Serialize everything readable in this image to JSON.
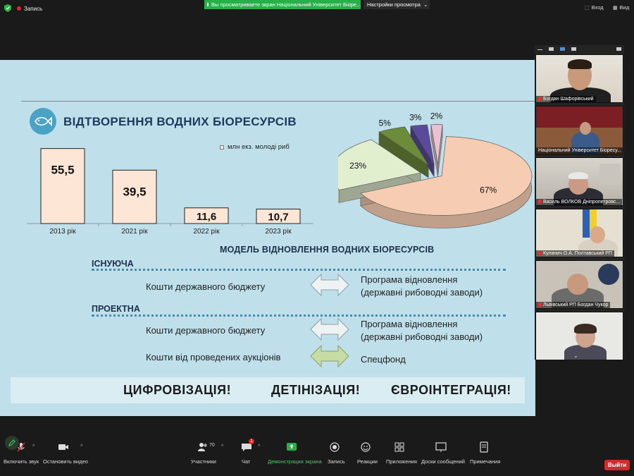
{
  "topbar": {
    "recording_label": "Запись",
    "share_banner": "Вы просматриваете экран Національний Університет Біоре...",
    "view_options": "Настройки просмотра",
    "exit_label": "Вход",
    "view_label": "Вид"
  },
  "slide": {
    "title": "ВІДТВОРЕННЯ ВОДНИХ БІОРЕСУРСІВ",
    "legend": "млн екз. молоді риб",
    "model_title": "МОДЕЛЬ ВІДНОВЛЕННЯ ВОДНИХ БІОРЕСУРСІВ",
    "existing_label": "ІСНУЮЧА",
    "project_label": "ПРОЕКТНА",
    "row1_source": "Кошти державного бюджету",
    "row1_dest_line1": "Програма відновлення",
    "row1_dest_line2": "(державні рибоводні заводи)",
    "row2_source": "Кошти державного бюджету",
    "row2_dest_line1": "Програма відновлення",
    "row2_dest_line2": "(державні рибоводні заводи)",
    "row3_source": "Кошти від проведених аукціонів",
    "row3_dest": "Спецфонд",
    "banner_1": "ЦИФРОВІЗАЦІЯ!",
    "banner_2": "ДЕТІНІЗАЦІЯ!",
    "banner_3": "ЄВРОІНТЕГРАЦІЯ!"
  },
  "chart_data": [
    {
      "type": "bar",
      "categories": [
        "2013 рік",
        "2021 рік",
        "2022 рік",
        "2023 рік"
      ],
      "values": [
        55.5,
        39.5,
        11.6,
        10.7
      ],
      "value_labels": [
        "55,5",
        "39,5",
        "11,6",
        "10,7"
      ],
      "legend": "млн екз. молоді риб",
      "ylim": [
        0,
        60
      ],
      "grid": false
    },
    {
      "type": "pie",
      "values": [
        67,
        23,
        5,
        3,
        2
      ],
      "labels": [
        "67%",
        "23%",
        "5%",
        "3%",
        "2%"
      ],
      "colors": [
        "#f6cdb2",
        "#e2efcf",
        "#6c8c3a",
        "#5a4a9a",
        "#e8c2d2"
      ]
    }
  ],
  "participants": [
    {
      "name": "Богдан Шафорівський",
      "muted": true
    },
    {
      "name": "Національний Університет Біоресу...",
      "muted": false
    },
    {
      "name": "Василь ВОЛКОВ Дніпропетровс...",
      "muted": true
    },
    {
      "name": "Кулинич О.А. Полтавський РП",
      "muted": true
    },
    {
      "name": "Львівський РП Богдан Чукор",
      "muted": true
    },
    {
      "name": "",
      "muted": false
    }
  ],
  "toolbar": {
    "mute": "Включить звук",
    "video": "Остановить видео",
    "participants": "Участники",
    "participants_count": "70",
    "chat": "Чат",
    "chat_badge": "1",
    "share": "Демонстрация экрана",
    "record": "Запись",
    "reactions": "Реакции",
    "apps": "Приложения",
    "whiteboards": "Доски сообщений",
    "notes": "Примечания",
    "leave": "Выйти"
  },
  "colors": {
    "slide_bg": "#bfe0ea",
    "bar_fill": "#fde6d6",
    "share_green": "#27b04a",
    "leave_red": "#d42a2a"
  }
}
